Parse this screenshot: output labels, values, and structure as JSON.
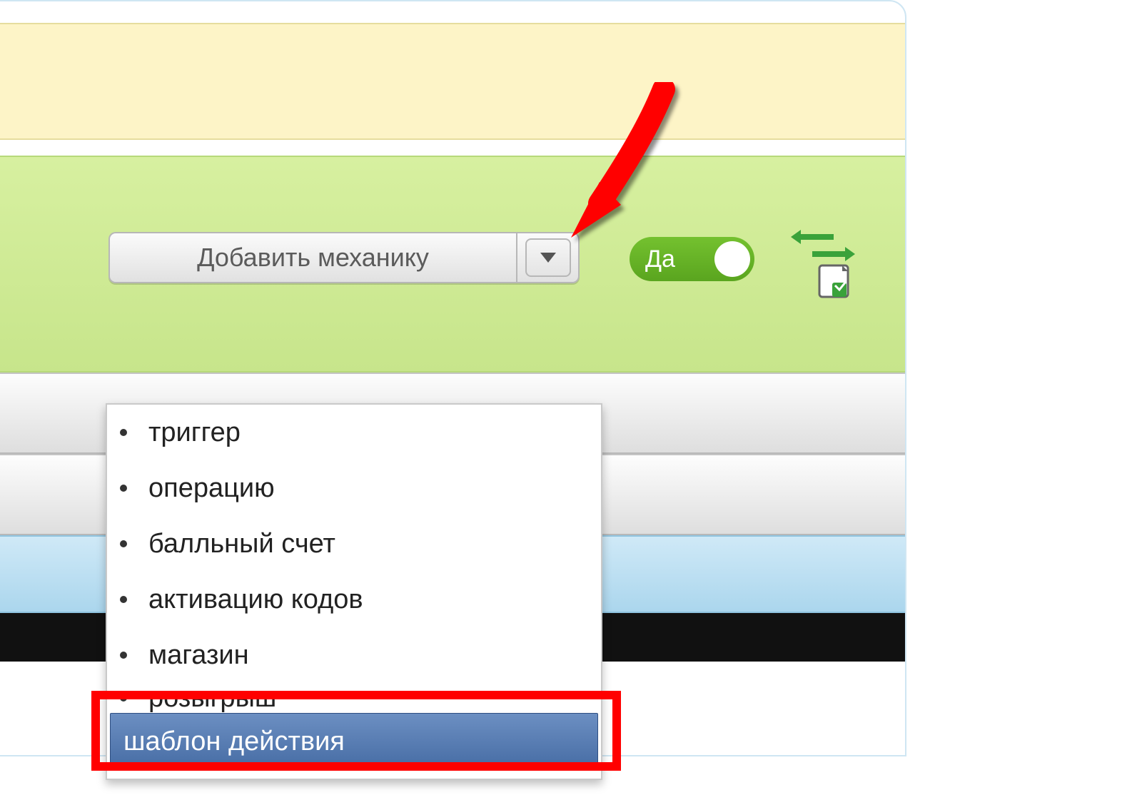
{
  "button": {
    "label": "Добавить механику"
  },
  "toggle": {
    "label": "Да",
    "on": true
  },
  "menu": {
    "items": [
      {
        "label": "триггер"
      },
      {
        "label": "операцию"
      },
      {
        "label": "балльный счет"
      },
      {
        "label": "активацию кодов"
      },
      {
        "label": "магазин"
      },
      {
        "label": "розыгрыш"
      },
      {
        "label": "шаблон действия",
        "selected": true
      }
    ]
  },
  "colors": {
    "accent_green": "#6ab82a",
    "highlight_red": "#ff0000",
    "select_blue": "#5a7fb4"
  }
}
